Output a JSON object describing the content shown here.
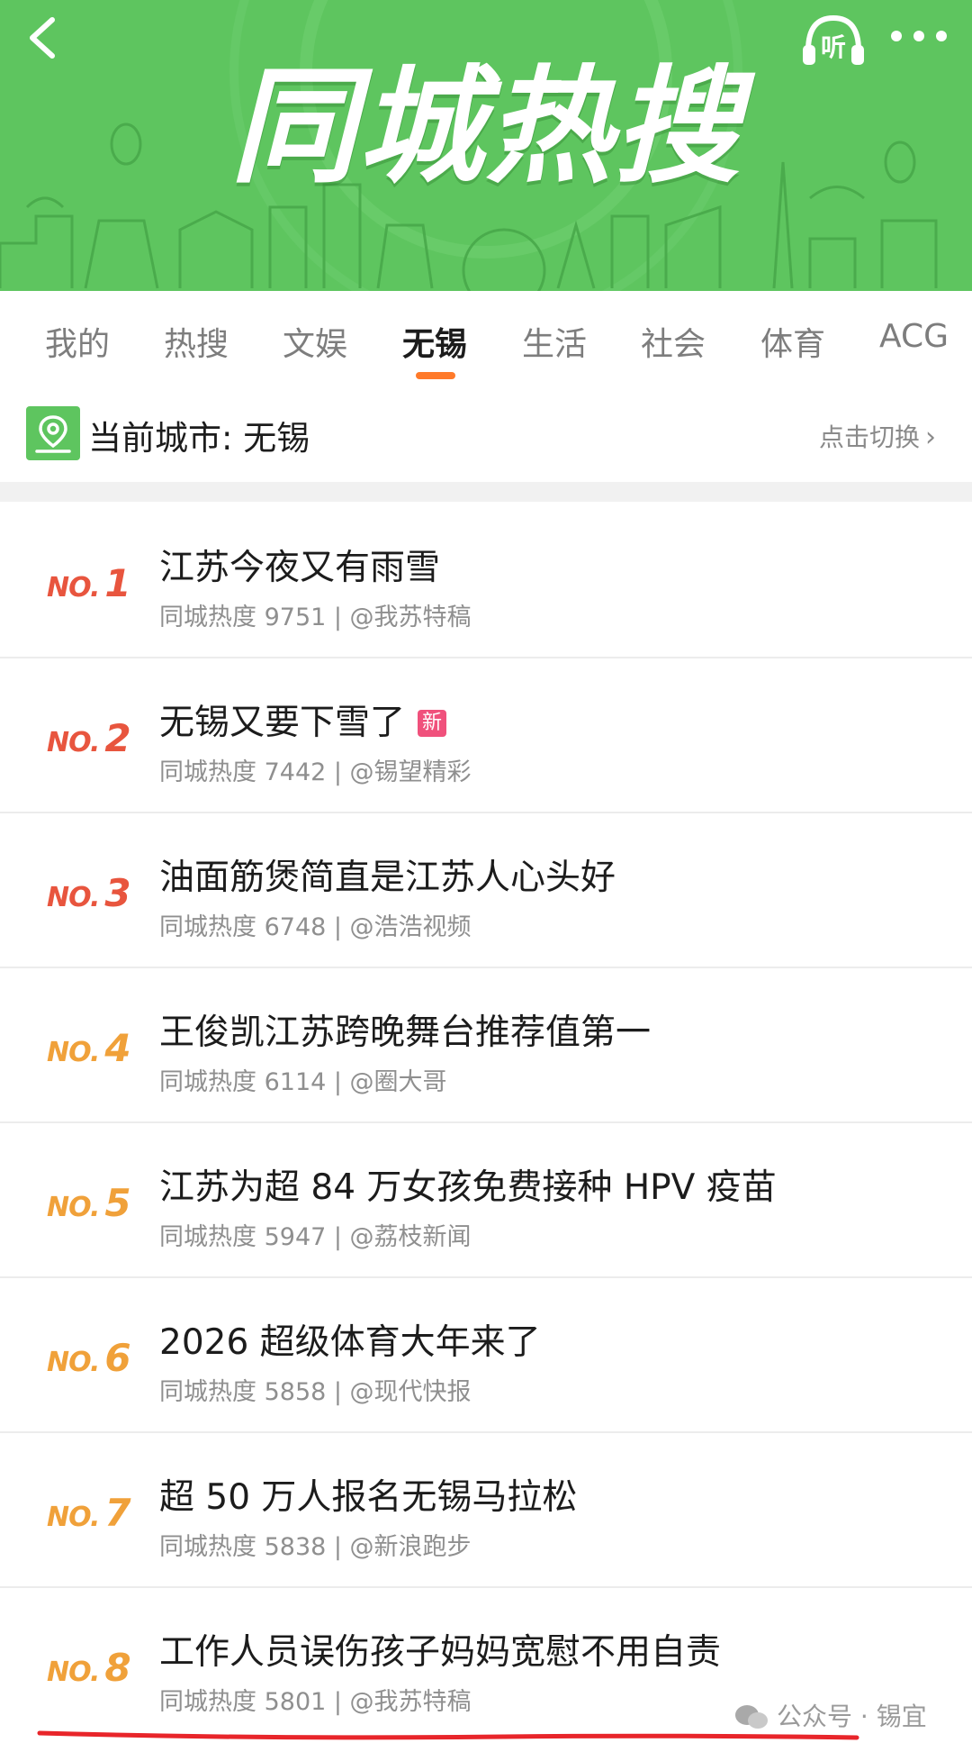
{
  "header": {
    "title": "同城热搜",
    "listen_label": "听",
    "accent_color": "#5ec55f"
  },
  "tabs": [
    {
      "label": "我的"
    },
    {
      "label": "热搜"
    },
    {
      "label": "文娱"
    },
    {
      "label": "无锡",
      "active": true
    },
    {
      "label": "生活"
    },
    {
      "label": "社会"
    },
    {
      "label": "体育"
    },
    {
      "label": "ACG"
    }
  ],
  "city": {
    "label": "当前城市: 无锡",
    "switch_label": "点击切换"
  },
  "list": [
    {
      "no": "NO.",
      "rank": "1",
      "title": "江苏今夜又有雨雪",
      "meta": "同城热度 9751 | @我苏特稿",
      "rank_color": "#e8553e"
    },
    {
      "no": "NO.",
      "rank": "2",
      "title": "无锡又要下雪了",
      "badge": "新",
      "meta": "同城热度 7442 | @锡望精彩",
      "rank_color": "#e8553e"
    },
    {
      "no": "NO.",
      "rank": "3",
      "title": "油面筋煲简直是江苏人心头好",
      "meta": "同城热度 6748 | @浩浩视频",
      "rank_color": "#e8553e"
    },
    {
      "no": "NO.",
      "rank": "4",
      "title": "王俊凯江苏跨晚舞台推荐值第一",
      "meta": "同城热度 6114 | @圈大哥",
      "rank_color": "#f0a13a"
    },
    {
      "no": "NO.",
      "rank": "5",
      "title": "江苏为超 84 万女孩免费接种 HPV 疫苗",
      "meta": "同城热度 5947 | @荔枝新闻",
      "rank_color": "#f0a13a"
    },
    {
      "no": "NO.",
      "rank": "6",
      "title": "2026 超级体育大年来了",
      "meta": "同城热度 5858 | @现代快报",
      "rank_color": "#f0a13a"
    },
    {
      "no": "NO.",
      "rank": "7",
      "title": "超 50 万人报名无锡马拉松",
      "meta": "同城热度 5838 | @新浪跑步",
      "rank_color": "#f0a13a"
    },
    {
      "no": "NO.",
      "rank": "8",
      "title": "工作人员误伤孩子妈妈宽慰不用自责",
      "meta": "同城热度 5801 | @我苏特稿",
      "rank_color": "#f0a13a"
    }
  ],
  "watermark": "公众号 · 锡宜",
  "annotation_color": "#e8252a"
}
